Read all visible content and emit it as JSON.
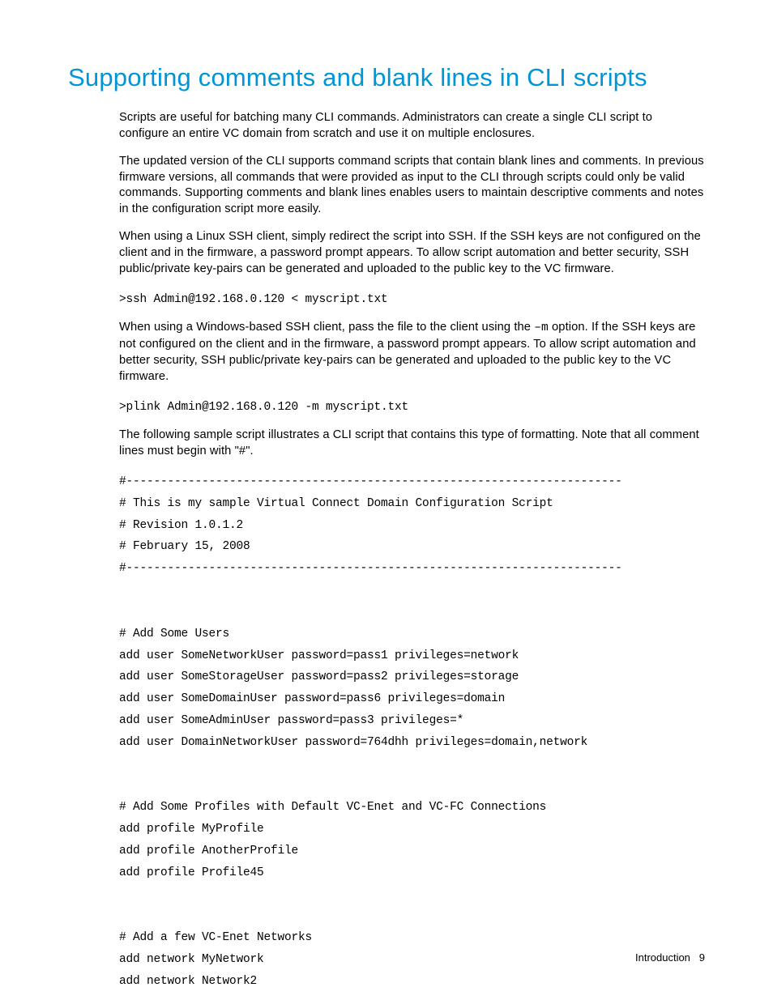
{
  "heading": "Supporting comments and blank lines in CLI scripts",
  "paragraphs": {
    "p1": "Scripts are useful for batching many CLI commands. Administrators can create a single CLI script to configure an entire VC domain from scratch and use it on multiple enclosures.",
    "p2": "The updated version of the CLI supports command scripts that contain blank lines and comments. In previous firmware versions, all commands that were provided as input to the CLI through scripts could only be valid commands. Supporting comments and blank lines enables users to maintain descriptive comments and notes in the configuration script more easily.",
    "p3": "When using a Linux SSH client, simply redirect the script into SSH. If the SSH keys are not configured on the client and in the firmware, a password prompt appears. To allow script automation and better security, SSH public/private key-pairs can be generated and uploaded to the public key to the VC firmware.",
    "code1": ">ssh Admin@192.168.0.120 < myscript.txt",
    "p4a": "When using a Windows-based SSH client, pass the file to the client using the ",
    "p4code": "–m",
    "p4b": " option. If the SSH keys are not configured on the client and in the firmware, a password prompt appears. To allow script automation and better security, SSH public/private key-pairs can be generated and uploaded to the public key to the VC firmware.",
    "code2": ">plink Admin@192.168.0.120 -m myscript.txt",
    "p5": "The following sample script illustrates a CLI script that contains this type of formatting. Note that all comment lines must begin with \"#\".",
    "script": "#------------------------------------------------------------------------\n# This is my sample Virtual Connect Domain Configuration Script\n# Revision 1.0.1.2\n# February 15, 2008\n#------------------------------------------------------------------------\n\n\n# Add Some Users\nadd user SomeNetworkUser password=pass1 privileges=network\nadd user SomeStorageUser password=pass2 privileges=storage\nadd user SomeDomainUser password=pass6 privileges=domain\nadd user SomeAdminUser password=pass3 privileges=*\nadd user DomainNetworkUser password=764dhh privileges=domain,network\n\n\n# Add Some Profiles with Default VC-Enet and VC-FC Connections\nadd profile MyProfile\nadd profile AnotherProfile\nadd profile Profile45\n\n\n# Add a few VC-Enet Networks\nadd network MyNetwork\nadd network Network2"
  },
  "footer": {
    "section": "Introduction",
    "page": "9"
  }
}
